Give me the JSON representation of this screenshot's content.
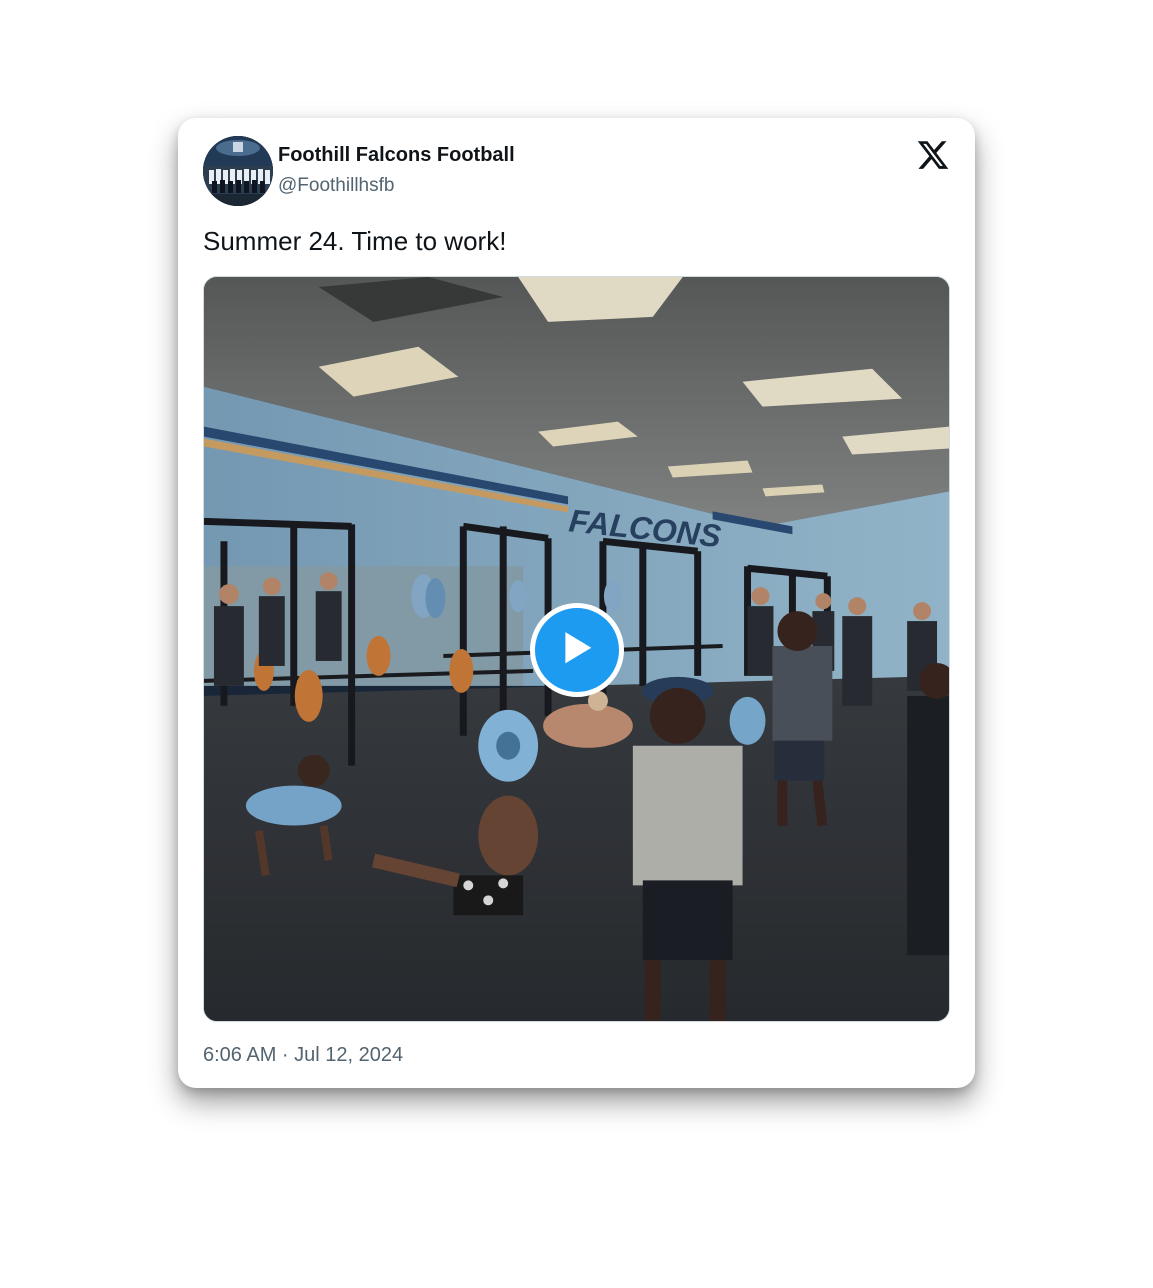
{
  "tweet": {
    "author": {
      "display_name": "Foothill Falcons Football",
      "handle": "@Foothillhsfb",
      "avatar_icon": "team-photo-avatar"
    },
    "text": "Summer 24. Time to work!",
    "media": {
      "type": "video",
      "wall_text": "FALCONS",
      "play_icon": "play-icon"
    },
    "timestamp": "6:06 AM · Jul 12, 2024"
  },
  "brand": {
    "logo_icon": "x-logo-icon",
    "accent_color": "#1d9bf0",
    "text_color": "#0f1419",
    "secondary_text_color": "#536471"
  }
}
